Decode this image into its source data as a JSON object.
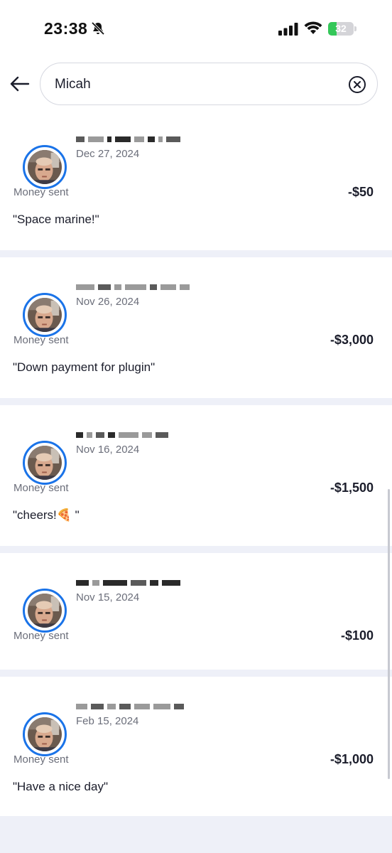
{
  "status_bar": {
    "time": "23:38",
    "battery_level": "32",
    "battery_fraction": 0.32,
    "icons": [
      "bell-slash-icon",
      "signal-icon",
      "wifi-icon",
      "battery-icon"
    ]
  },
  "search": {
    "value": "Micah",
    "back_icon": "arrow-left-icon",
    "clear_icon": "clear-circle-x-icon"
  },
  "colors": {
    "accent": "#1a73e8",
    "divider": "#eef0f8",
    "battery": "#34c759"
  },
  "transactions": [
    {
      "date": "Dec 27, 2024",
      "type": "Money sent",
      "amount": "-$50",
      "note": "\"Space marine!\""
    },
    {
      "date": "Nov 26, 2024",
      "type": "Money sent",
      "amount": "-$3,000",
      "note": "\"Down payment for plugin\""
    },
    {
      "date": "Nov 16, 2024",
      "type": "Money sent",
      "amount": "-$1,500",
      "note": "\"cheers!🍕 \""
    },
    {
      "date": "Nov 15, 2024",
      "type": "Money sent",
      "amount": "-$100",
      "note": ""
    },
    {
      "date": "Feb 15, 2024",
      "type": "Money sent",
      "amount": "-$1,000",
      "note": "\"Have a nice day\""
    }
  ]
}
